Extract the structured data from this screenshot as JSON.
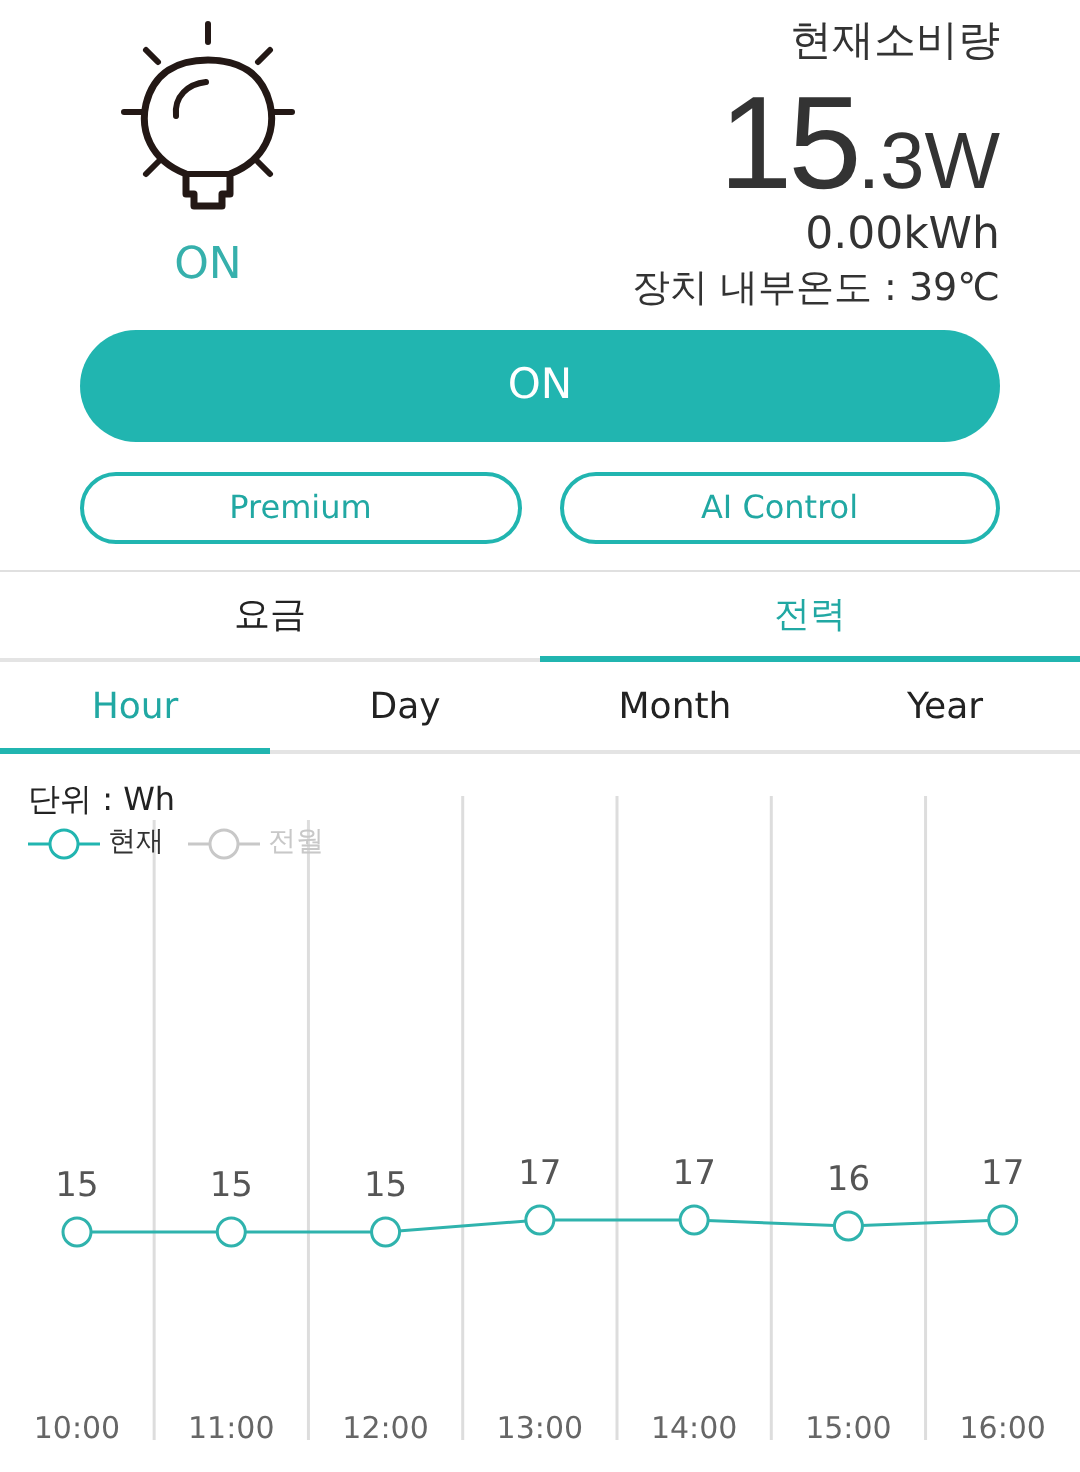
{
  "device": {
    "status": "ON",
    "on": true
  },
  "consumption": {
    "title": "현재소비량",
    "watts_whole": "15",
    "watts_fraction": ".3W",
    "energy": "0.00kWh",
    "temperature": "장치 내부온도 : 39℃"
  },
  "power_button": {
    "label": "ON",
    "on": true
  },
  "mode_buttons": [
    "Premium",
    "AI Control"
  ],
  "tabs": [
    {
      "label": "요금",
      "selected": false
    },
    {
      "label": "전력",
      "selected": true
    }
  ],
  "period_tabs": [
    {
      "label": "Hour",
      "selected": true
    },
    {
      "label": "Day",
      "selected": false
    },
    {
      "label": "Month",
      "selected": false
    },
    {
      "label": "Year",
      "selected": false
    }
  ],
  "chart": {
    "unit": "단위 : Wh",
    "legend": [
      {
        "selected": true
      },
      {
        "label": "전월",
        "selected": false
      }
    ],
    "chart_data": {
      "type": "line",
      "categories": [
        "10:00",
        "11:00",
        "12:00",
        "13:00",
        "14:00",
        "15:00",
        "16:00"
      ],
      "data_labels": true,
      "series": [
        {
          "name": "현재",
          "color": "#2fb3ad",
          "marker": "circle",
          "values": [
            15,
            15,
            15,
            17,
            17,
            16,
            17
          ]
        }
      ]
    }
  }
}
